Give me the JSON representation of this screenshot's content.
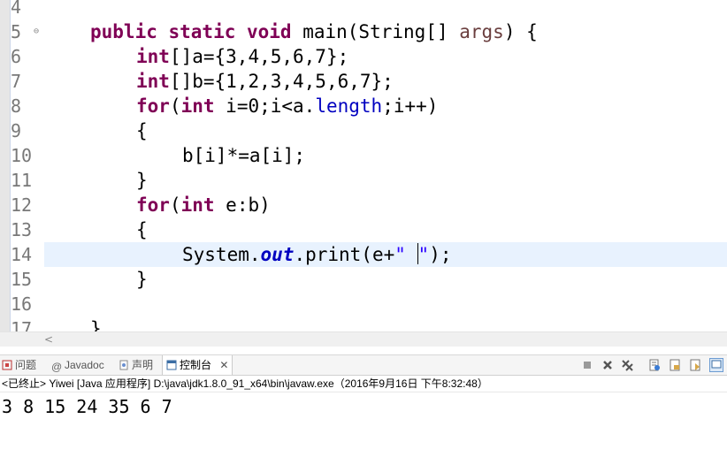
{
  "editor": {
    "lines": [
      {
        "num": "4"
      },
      {
        "num": "5"
      },
      {
        "num": "6"
      },
      {
        "num": "7"
      },
      {
        "num": "8"
      },
      {
        "num": "9"
      },
      {
        "num": "10"
      },
      {
        "num": "11"
      },
      {
        "num": "12"
      },
      {
        "num": "13"
      },
      {
        "num": "14"
      },
      {
        "num": "15"
      },
      {
        "num": "16"
      },
      {
        "num": "17"
      }
    ],
    "code": {
      "l5_kw": "public static void",
      "l5_rest": " main(String[] ",
      "l5_args": "args",
      "l5_end": ") {",
      "l6_kw": "int",
      "l6_rest": "[]a={3,4,5,6,7};",
      "l7_kw": "int",
      "l7_rest": "[]b={1,2,3,4,5,6,7};",
      "l8_kw1": "for",
      "l8_p": "(",
      "l8_kw2": "int",
      "l8_a": " i=0;i<a.",
      "l8_field": "length",
      "l8_b": ";i++)",
      "l9": "{",
      "l10": "b[i]*=a[i];",
      "l11": "}",
      "l12_kw1": "for",
      "l12_p": "(",
      "l12_kw2": "int",
      "l12_rest": " e:b)",
      "l13": "{",
      "l14_a": "System.",
      "l14_out": "out",
      "l14_b": ".print(e+",
      "l14_str1": "\" ",
      "l14_str2": "\"",
      "l14_end": ");",
      "l15": "}",
      "l17": "}"
    }
  },
  "console": {
    "tabs": [
      {
        "label": "问题",
        "icon": "problems-icon"
      },
      {
        "label": "Javadoc",
        "icon": "at-icon"
      },
      {
        "label": "声明",
        "icon": "declaration-icon"
      },
      {
        "label": "控制台",
        "icon": "console-icon"
      }
    ],
    "status": "<已终止> Yiwei [Java 应用程序] D:\\java\\jdk1.8.0_91_x64\\bin\\javaw.exe（2016年9月16日 下午8:32:48）",
    "output": "3 8 15 24 35 6 7"
  }
}
